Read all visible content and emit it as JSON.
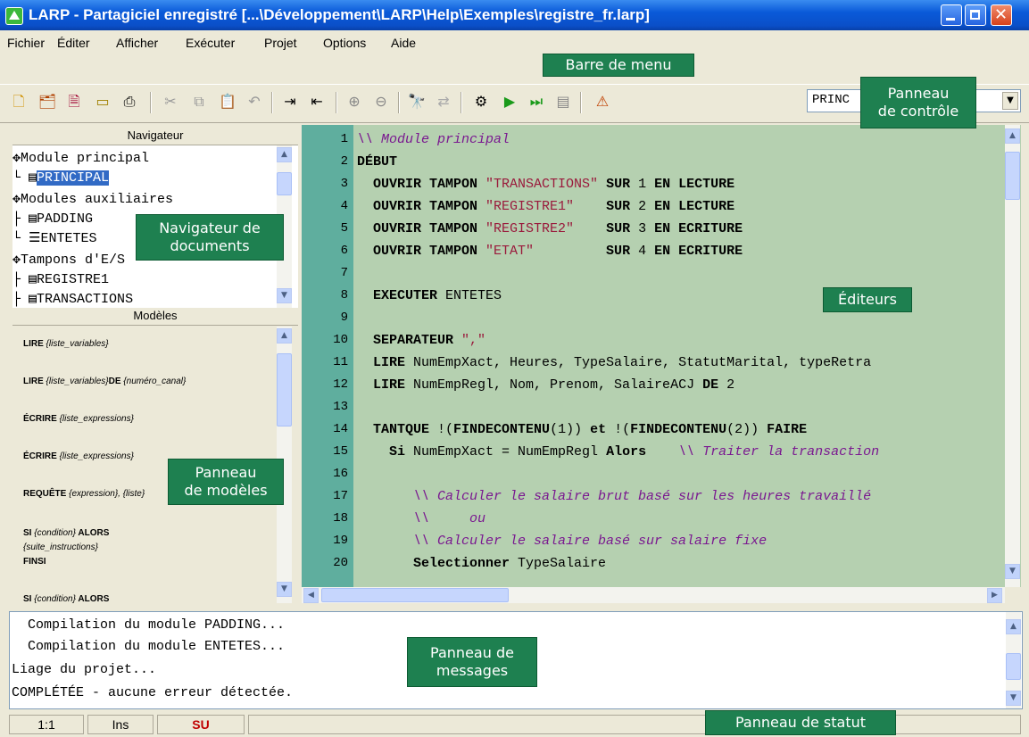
{
  "window": {
    "title": "LARP - Partagiciel enregistré [...\\Développement\\LARP\\Help\\Exemples\\registre_fr.larp]",
    "close_glyph": "✕"
  },
  "menu": {
    "items": [
      "Fichier",
      "Éditer",
      "Afficher",
      "Exécuter",
      "Projet",
      "Options",
      "Aide"
    ]
  },
  "toolbar": {
    "icons": [
      "new-file-icon",
      "open-icon",
      "save-icon",
      "folder-icon",
      "print-icon",
      "cut-icon",
      "copy-icon",
      "paste-icon",
      "undo-icon",
      "indent-icon",
      "outdent-icon",
      "zoom-in-icon",
      "zoom-out-icon",
      "find-icon",
      "replace-icon",
      "compile-icon",
      "run-icon",
      "step-icon",
      "output-icon",
      "debug-icon"
    ],
    "module_value": "PRINC"
  },
  "navigator": {
    "header": "Navigateur",
    "rows": [
      {
        "prefix": "✥",
        "label": "Module principal"
      },
      {
        "prefix": " └ ▤",
        "label": "PRINCIPAL"
      },
      {
        "prefix": "✥",
        "label": "Modules auxiliaires"
      },
      {
        "prefix": " ├ ▤",
        "label": "PADDING"
      },
      {
        "prefix": " └ ☰",
        "label": "ENTETES"
      },
      {
        "prefix": "✥",
        "label": "Tampons d'E/S"
      },
      {
        "prefix": " ├ ▤",
        "label": "REGISTRE1"
      },
      {
        "prefix": " ├ ▤",
        "label": "TRANSACTIONS"
      }
    ]
  },
  "templates": {
    "header": "Modèles",
    "items": [
      {
        "kw": "LIRE",
        "rest": " {liste_variables}"
      },
      {
        "kw": "LIRE",
        "rest": " {liste_variables}",
        "kw2": "DE",
        "rest2": " {numéro_canal}"
      },
      {
        "kw": "ÉCRIRE",
        "rest": " {liste_expressions}"
      },
      {
        "kw": "ÉCRIRE",
        "rest": " {liste_expressions}"
      },
      {
        "kw": "REQUÊTE",
        "rest": " {expression}, {liste}"
      },
      {
        "kw": "SI",
        "rest": " {condition}",
        "kw2": " ALORS",
        "rest2": ""
      },
      {
        "kw": "",
        "rest": "   {suite_instructions}"
      },
      {
        "kw": "FINSI",
        "rest": ""
      },
      {
        "kw": "SI",
        "rest": " {condition}",
        "kw2": " ALORS",
        "rest2": ""
      }
    ]
  },
  "editor": {
    "line_numbers": [
      "1",
      "2",
      "3",
      "4",
      "5",
      "6",
      "7",
      "8",
      "9",
      "10",
      "11",
      "12",
      "13",
      "14",
      "15",
      "16",
      "17",
      "18",
      "19",
      "20"
    ],
    "lines": [
      [
        {
          "t": "c",
          "v": "\\\\ Module principal"
        }
      ],
      [
        {
          "t": "k",
          "v": "DÉBUT"
        }
      ],
      [
        {
          "t": "k",
          "v": "  OUVRIR TAMPON "
        },
        {
          "t": "s",
          "v": "\"TRANSACTIONS\""
        },
        {
          "t": "k",
          "v": " SUR "
        },
        {
          "t": "n",
          "v": "1"
        },
        {
          "t": "k",
          "v": " EN LECTURE"
        }
      ],
      [
        {
          "t": "k",
          "v": "  OUVRIR TAMPON "
        },
        {
          "t": "s",
          "v": "\"REGISTRE1\""
        },
        {
          "t": "k",
          "v": "    SUR "
        },
        {
          "t": "n",
          "v": "2"
        },
        {
          "t": "k",
          "v": " EN LECTURE"
        }
      ],
      [
        {
          "t": "k",
          "v": "  OUVRIR TAMPON "
        },
        {
          "t": "s",
          "v": "\"REGISTRE2\""
        },
        {
          "t": "k",
          "v": "    SUR "
        },
        {
          "t": "n",
          "v": "3"
        },
        {
          "t": "k",
          "v": " EN ECRITURE"
        }
      ],
      [
        {
          "t": "k",
          "v": "  OUVRIR TAMPON "
        },
        {
          "t": "s",
          "v": "\"ETAT\""
        },
        {
          "t": "k",
          "v": "         SUR "
        },
        {
          "t": "n",
          "v": "4"
        },
        {
          "t": "k",
          "v": " EN ECRITURE"
        }
      ],
      [
        {
          "t": "n",
          "v": ""
        }
      ],
      [
        {
          "t": "k",
          "v": "  EXECUTER "
        },
        {
          "t": "n",
          "v": "ENTETES"
        }
      ],
      [
        {
          "t": "n",
          "v": ""
        }
      ],
      [
        {
          "t": "k",
          "v": "  SEPARATEUR "
        },
        {
          "t": "s",
          "v": "\",\""
        }
      ],
      [
        {
          "t": "k",
          "v": "  LIRE "
        },
        {
          "t": "n",
          "v": "NumEmpXact, Heures, TypeSalaire, StatutMarital, typeRetra"
        }
      ],
      [
        {
          "t": "k",
          "v": "  LIRE "
        },
        {
          "t": "n",
          "v": "NumEmpRegl, Nom, Prenom, SalaireACJ "
        },
        {
          "t": "k",
          "v": "DE"
        },
        {
          "t": "n",
          "v": " 2"
        }
      ],
      [
        {
          "t": "n",
          "v": ""
        }
      ],
      [
        {
          "t": "k",
          "v": "  TANTQUE "
        },
        {
          "t": "n",
          "v": "!("
        },
        {
          "t": "k",
          "v": "FINDECONTENU"
        },
        {
          "t": "n",
          "v": "(1)) "
        },
        {
          "t": "k",
          "v": "et"
        },
        {
          "t": "n",
          "v": " !("
        },
        {
          "t": "k",
          "v": "FINDECONTENU"
        },
        {
          "t": "n",
          "v": "(2)) "
        },
        {
          "t": "k",
          "v": "FAIRE"
        }
      ],
      [
        {
          "t": "k",
          "v": "    Si "
        },
        {
          "t": "n",
          "v": "NumEmpXact = NumEmpRegl "
        },
        {
          "t": "k",
          "v": "Alors"
        },
        {
          "t": "c",
          "v": "    \\\\ Traiter la transaction"
        }
      ],
      [
        {
          "t": "n",
          "v": ""
        }
      ],
      [
        {
          "t": "c",
          "v": "       \\\\ Calculer le salaire brut basé sur les heures travaillé"
        }
      ],
      [
        {
          "t": "c",
          "v": "       \\\\     ou"
        }
      ],
      [
        {
          "t": "c",
          "v": "       \\\\ Calculer le salaire basé sur salaire fixe"
        }
      ],
      [
        {
          "t": "k",
          "v": "       Selectionner "
        },
        {
          "t": "n",
          "v": "TypeSalaire"
        }
      ]
    ]
  },
  "messages": {
    "lines": [
      "  Compilation du module PADDING...",
      "  Compilation du module ENTETES...",
      "Liage du projet...",
      "COMPLÉTÉE - aucune erreur détectée."
    ]
  },
  "status": {
    "position": "1:1",
    "mode": "Ins",
    "su": "SU"
  },
  "callouts": {
    "menu": "Barre de menu",
    "control_1": "Panneau",
    "control_2": "de contrôle",
    "nav_1": "Navigateur de",
    "nav_2": "documents",
    "editors": "Éditeurs",
    "templ_1": "Panneau",
    "templ_2": "de modèles",
    "msg_1": "Panneau de",
    "msg_2": "messages",
    "status": "Panneau de statut"
  },
  "colors": {
    "callout": "#1e8050",
    "editor_bg": "#b5d0b0",
    "gutter": "#5fae9e",
    "keyword": "#000000",
    "string": "#9a1a3c",
    "comment": "#7a1890"
  }
}
